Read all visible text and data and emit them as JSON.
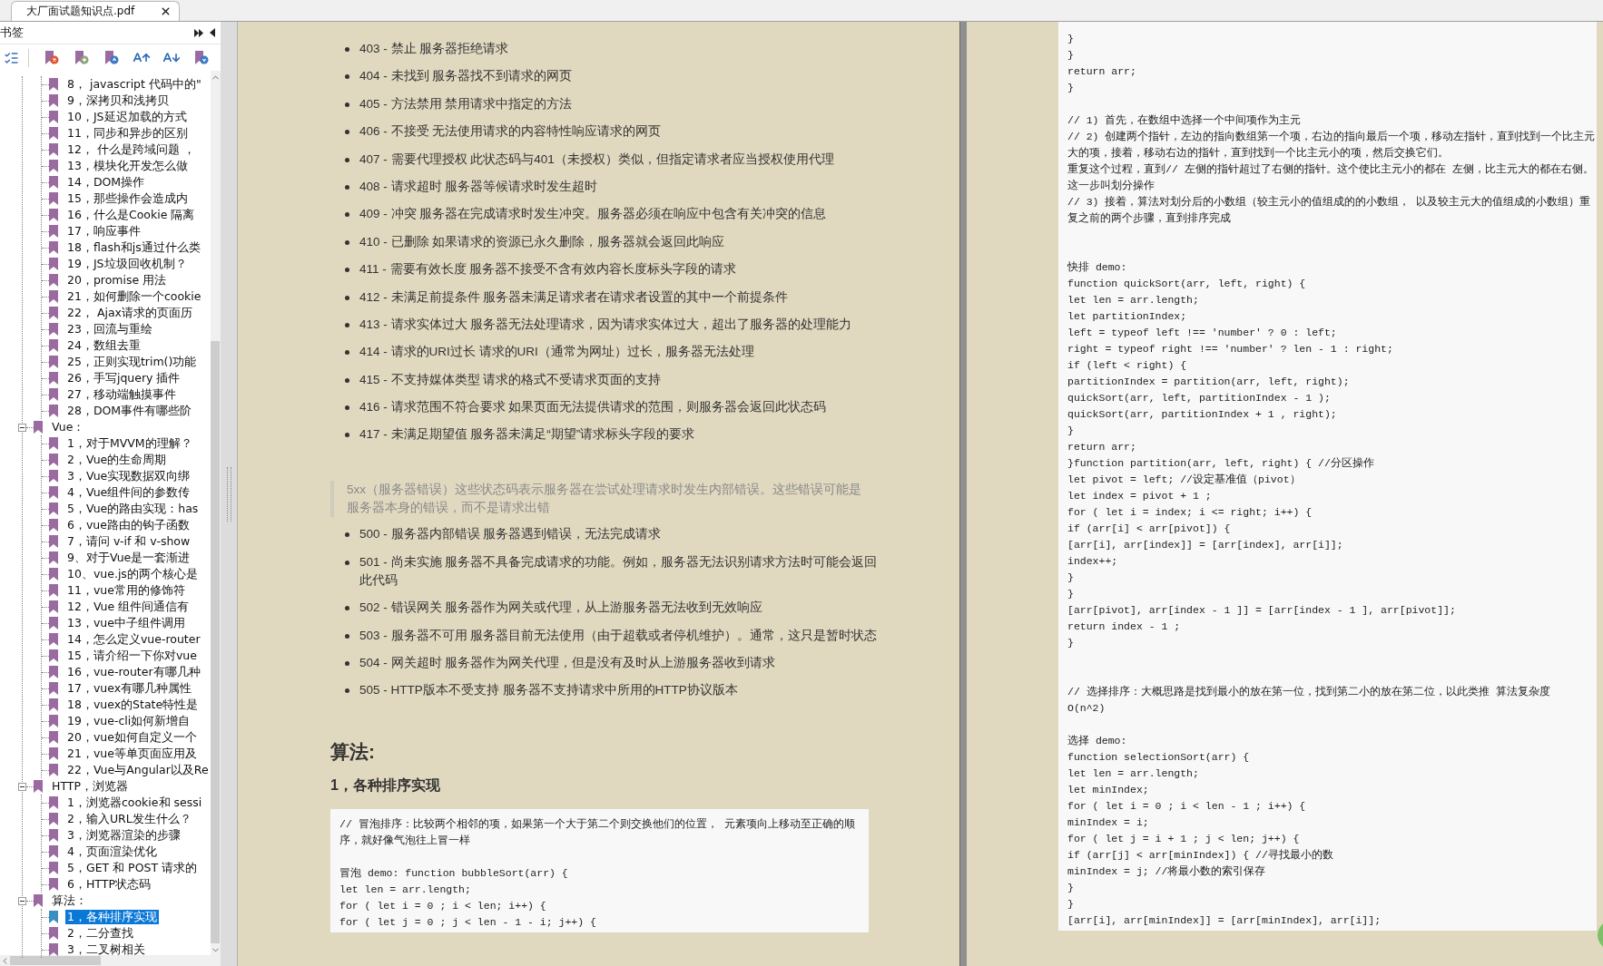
{
  "tab": {
    "title": "大厂面试题知识点.pdf"
  },
  "bookmarks": {
    "title": "书签",
    "continued": [
      {
        "label": "8， javascript 代码中的\"",
        "selected": false
      },
      {
        "label": "9，深拷贝和浅拷贝",
        "selected": false
      },
      {
        "label": "10，JS延迟加载的方式",
        "selected": false
      },
      {
        "label": "11，同步和异步的区别",
        "selected": false
      },
      {
        "label": "12， 什么是跨域问题 ，",
        "selected": false
      },
      {
        "label": "13，模块化开发怎么做",
        "selected": false
      },
      {
        "label": "14，DOM操作",
        "selected": false
      },
      {
        "label": "15，那些操作会造成内",
        "selected": false
      },
      {
        "label": "16，什么是Cookie 隔离",
        "selected": false
      },
      {
        "label": "17，响应事件",
        "selected": false
      },
      {
        "label": "18，flash和js通过什么类",
        "selected": false
      },
      {
        "label": "19，JS垃圾回收机制？",
        "selected": false
      },
      {
        "label": "20，promise 用法",
        "selected": false
      },
      {
        "label": "21，如何删除一个cookie",
        "selected": false
      },
      {
        "label": "22， Ajax请求的页面历",
        "selected": false
      },
      {
        "label": "23，回流与重绘",
        "selected": false
      },
      {
        "label": "24，数组去重",
        "selected": false
      },
      {
        "label": "25，正则实现trim()功能",
        "selected": false
      },
      {
        "label": "26，手写jquery 插件",
        "selected": false
      },
      {
        "label": "27，移动端触摸事件",
        "selected": false
      },
      {
        "label": "28，DOM事件有哪些阶",
        "selected": false
      }
    ],
    "sections": [
      {
        "label": "Vue：",
        "expanded": true,
        "children": [
          {
            "label": "1，对于MVVM的理解？",
            "selected": false
          },
          {
            "label": "2，Vue的生命周期",
            "selected": false
          },
          {
            "label": "3，Vue实现数据双向绑",
            "selected": false
          },
          {
            "label": "4，Vue组件间的参数传",
            "selected": false
          },
          {
            "label": "5，Vue的路由实现：has",
            "selected": false
          },
          {
            "label": "6，vue路由的钩子函数",
            "selected": false
          },
          {
            "label": "7，请问 v-if 和 v-show",
            "selected": false
          },
          {
            "label": "9、对于Vue是一套渐进",
            "selected": false
          },
          {
            "label": "10、vue.js的两个核心是",
            "selected": false
          },
          {
            "label": "11，vue常用的修饰符",
            "selected": false
          },
          {
            "label": "12，Vue 组件间通信有",
            "selected": false
          },
          {
            "label": "13，vue中子组件调用",
            "selected": false
          },
          {
            "label": "14，怎么定义vue-router",
            "selected": false
          },
          {
            "label": "15，请介绍一下你对vue",
            "selected": false
          },
          {
            "label": "16，vue-router有哪几种",
            "selected": false
          },
          {
            "label": "17，vuex有哪几种属性",
            "selected": false
          },
          {
            "label": "18，vuex的State特性是",
            "selected": false
          },
          {
            "label": "19，vue-cli如何新增自",
            "selected": false
          },
          {
            "label": "20，vue如何自定义一个",
            "selected": false
          },
          {
            "label": "21，vue等单页面应用及",
            "selected": false
          },
          {
            "label": "22，Vue与Angular以及Re",
            "selected": false
          }
        ]
      },
      {
        "label": "HTTP，浏览器",
        "expanded": true,
        "children": [
          {
            "label": "1，浏览器cookie和 sessi",
            "selected": false
          },
          {
            "label": "2，输入URL发生什么？",
            "selected": false
          },
          {
            "label": "3，浏览器渲染的步骤",
            "selected": false
          },
          {
            "label": "4，页面渲染优化",
            "selected": false
          },
          {
            "label": "5，GET 和 POST 请求的",
            "selected": false
          },
          {
            "label": "6，HTTP状态码",
            "selected": false
          }
        ]
      },
      {
        "label": "算法：",
        "expanded": true,
        "children": [
          {
            "label": "1，各种排序实现",
            "selected": true
          },
          {
            "label": "2，二分查找",
            "selected": false
          },
          {
            "label": "3，二叉树相关",
            "selected": false
          }
        ]
      }
    ]
  },
  "left_page": {
    "status_4xx": [
      "403 - 禁止 服务器拒绝请求",
      "404 - 未找到 服务器找不到请求的网页",
      "405 - 方法禁用 禁用请求中指定的方法",
      "406 - 不接受 无法使用请求的内容特性响应请求的网页",
      "407 - 需要代理授权 此状态码与401（未授权）类似，但指定请求者应当授权使用代理",
      "408 - 请求超时 服务器等候请求时发生超时",
      "409 - 冲突 服务器在完成请求时发生冲突。服务器必须在响应中包含有关冲突的信息",
      "410 - 已删除 如果请求的资源已永久删除，服务器就会返回此响应",
      "411 - 需要有效长度 服务器不接受不含有效内容长度标头字段的请求",
      "412 - 未满足前提条件 服务器未满足请求者在请求者设置的其中一个前提条件",
      "413 - 请求实体过大 服务器无法处理请求，因为请求实体过大，超出了服务器的处理能力",
      "414 - 请求的URI过长 请求的URI（通常为网址）过长，服务器无法处理",
      "415 - 不支持媒体类型 请求的格式不受请求页面的支持",
      "416 - 请求范围不符合要求 如果页面无法提供请求的范围，则服务器会返回此状态码",
      "417 - 未满足期望值 服务器未满足“期望”请求标头字段的要求"
    ],
    "note": "5xx（服务器错误）这些状态码表示服务器在尝试处理请求时发生内部错误。这些错误可能是服务器本身的错误，而不是请求出错",
    "status_5xx": [
      "500 - 服务器内部错误 服务器遇到错误，无法完成请求",
      "501 - 尚未实施 服务器不具备完成请求的功能。例如，服务器无法识别请求方法时可能会返回此代码",
      "502 - 错误网关 服务器作为网关或代理，从上游服务器无法收到无效响应",
      "503 - 服务器不可用 服务器目前无法使用（由于超载或者停机维护）。通常，这只是暂时状态",
      "504 - 网关超时 服务器作为网关代理，但是没有及时从上游服务器收到请求",
      "505 - HTTP版本不受支持 服务器不支持请求中所用的HTTP协议版本"
    ],
    "heading": "算法:",
    "subheading": "1，各种排序实现",
    "code": [
      {
        "kind": "first",
        "lines": [
          "// 冒泡排序：比较两个相邻的项，如果第一个大于第二个则交换他们的位置， 元素项向上移动至正确的顺",
          "序，就好像气泡往上冒一样"
        ]
      },
      {
        "kind": "paragraph",
        "lines": [
          "冒泡 demo: function bubbleSort(arr) {",
          "let len = arr.length;",
          "for ( let i = 0 ; i < len; i++) {",
          "for ( let j = 0 ; j < len - 1 - i; j++) {"
        ]
      }
    ]
  },
  "right_page": {
    "code": [
      {
        "kind": "first",
        "lines": [
          "}",
          "}",
          "return arr;",
          "}"
        ]
      },
      {
        "kind": "paragraph",
        "lines": [
          "// 1) 首先，在数组中选择一个中间项作为主元",
          "// 2) 创建两个指针，左边的指向数组第一个项，右边的指向最后一个项，移动左指针，直到找到一个比主元",
          "大的项，接着，移动右边的指针，直到找到一个比主元小的项，然后交换它们。",
          "重复这个过程，直到// 左侧的指针超过了右侧的指针。这个使比主元小的都在 左侧，比主元大的都在右侧。",
          "这一步叫划分操作",
          "// 3) 接着，算法对划分后的小数组（较主元小的值组成的的小数组， 以及较主元大的值组成的小数组）重",
          "复之前的两个步骤，直到排序完成"
        ]
      },
      {
        "kind": "section",
        "lines": [
          "快排 demo:",
          "function quickSort(arr, left, right) {",
          "let len = arr.length;",
          "let partitionIndex;",
          "left = typeof left !== 'number' ? 0 : left;",
          "right = typeof right !== 'number' ? len - 1 : right;",
          "if (left < right) {",
          "partitionIndex = partition(arr, left, right);",
          "quickSort(arr, left, partitionIndex - 1 );",
          "quickSort(arr, partitionIndex + 1 , right);",
          "}",
          "return arr;",
          "}function partition(arr, left, right) { //分区操作",
          "let pivot = left; //设定基准值（pivot）",
          "let index = pivot + 1 ;",
          "for ( let i = index; i <= right; i++) {",
          "if (arr[i] < arr[pivot]) {",
          "[arr[i], arr[index]] = [arr[index], arr[i]];",
          "index++;",
          "}",
          "}",
          "[arr[pivot], arr[index - 1 ]] = [arr[index - 1 ], arr[pivot]];",
          "return index - 1 ;",
          "}"
        ]
      },
      {
        "kind": "section",
        "lines": [
          "// 选择排序：大概思路是找到最小的放在第一位，找到第二小的放在第二位，以此类推 算法复杂度",
          "O(n^2)"
        ]
      },
      {
        "kind": "paragraph",
        "lines": [
          "选择 demo:",
          "function selectionSort(arr) {",
          "let len = arr.length;",
          "let minIndex;",
          "for ( let i = 0 ; i < len - 1 ; i++) {",
          "minIndex = i;",
          "for ( let j = i + 1 ; j < len; j++) {",
          "if (arr[j] < arr[minIndex]) { //寻找最小的数",
          "minIndex = j; //将最小数的索引保存",
          "}",
          "}",
          "[arr[i], arr[minIndex]] = [arr[minIndex], arr[i]];"
        ]
      }
    ]
  }
}
